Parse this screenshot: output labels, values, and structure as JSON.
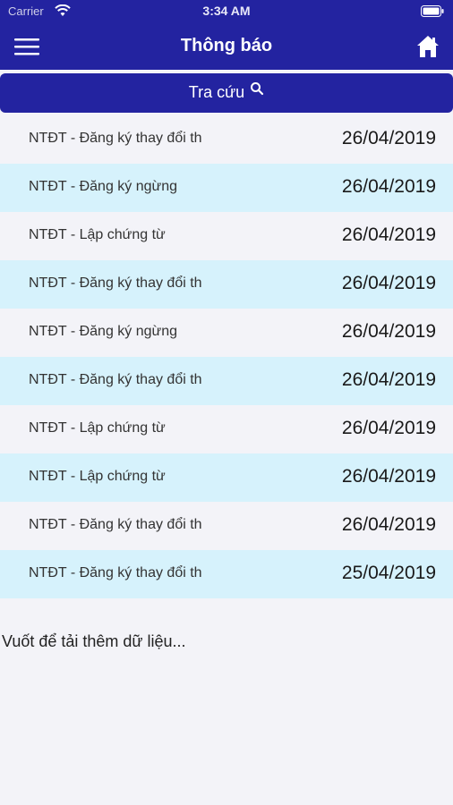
{
  "status_bar": {
    "carrier": "Carrier",
    "time": "3:34 AM"
  },
  "nav": {
    "title": "Thông báo",
    "menu_icon": "hamburger-menu-icon",
    "home_icon": "home-icon"
  },
  "search": {
    "label": "Tra cứu",
    "icon": "search-icon"
  },
  "notifications": [
    {
      "title": "NTĐT - Đăng ký thay đổi th",
      "date": "26/04/2019"
    },
    {
      "title": "NTĐT - Đăng ký ngừng",
      "date": "26/04/2019"
    },
    {
      "title": "NTĐT - Lập chứng từ",
      "date": "26/04/2019"
    },
    {
      "title": "NTĐT - Đăng ký thay đổi th",
      "date": "26/04/2019"
    },
    {
      "title": "NTĐT - Đăng ký ngừng",
      "date": "26/04/2019"
    },
    {
      "title": "NTĐT - Đăng ký thay đổi th",
      "date": "26/04/2019"
    },
    {
      "title": "NTĐT - Lập chứng từ",
      "date": "26/04/2019"
    },
    {
      "title": "NTĐT - Lập chứng từ",
      "date": "26/04/2019"
    },
    {
      "title": "NTĐT - Đăng ký thay đổi th",
      "date": "26/04/2019"
    },
    {
      "title": "NTĐT - Đăng ký thay đổi th",
      "date": "25/04/2019"
    }
  ],
  "load_more": "Vuốt để tải thêm dữ liệu...",
  "colors": {
    "primary": "#2323a0",
    "row_alt": "#d6f2fc",
    "background": "#f3f3f8"
  }
}
